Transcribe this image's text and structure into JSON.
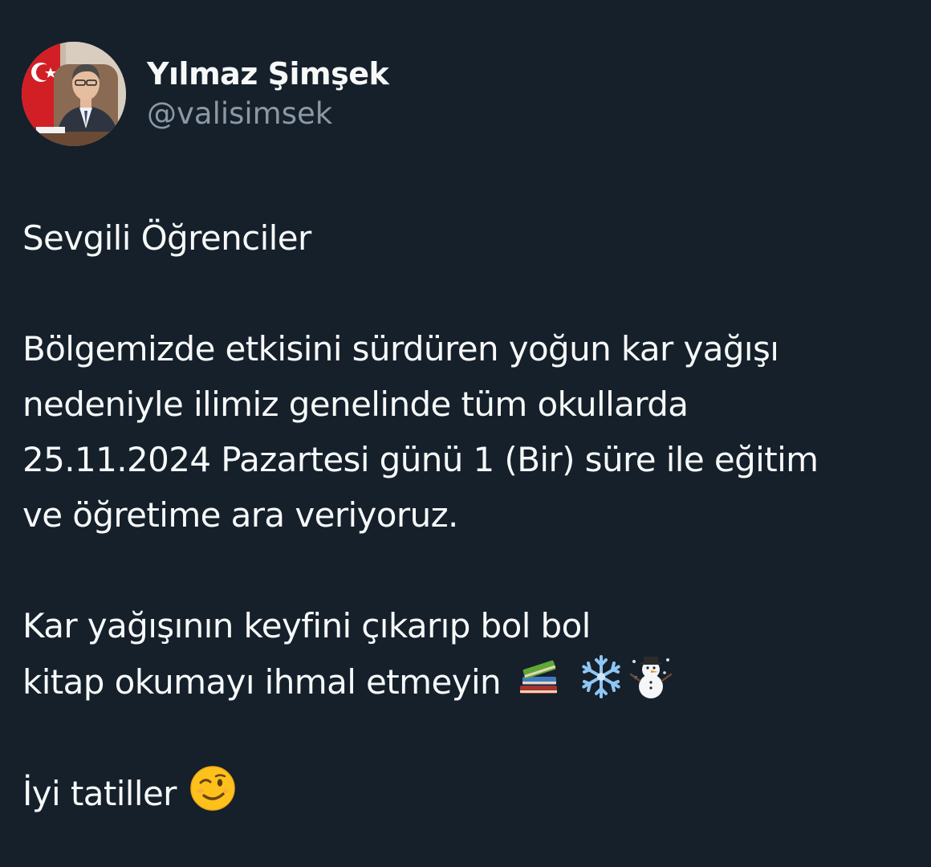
{
  "author": {
    "display_name": "Yılmaz Şimşek",
    "handle": "@valisimsek",
    "avatar_icon": "profile-photo"
  },
  "tweet": {
    "greeting": "Sevgili Öğrenciler",
    "lines": [
      "Bölgemizde etkisini sürdüren yoğun kar yağışı",
      "nedeniyle ilimiz genelinde tüm okullarda",
      "25.11.2024 Pazartesi günü 1 (Bir) süre ile eğitim",
      "ve öğretime ara veriyoruz."
    ],
    "wish_line_1": "Kar yağışının keyfini çıkarıp bol bol",
    "wish_line_2": "kitap okumayı ihmal etmeyin",
    "wish_emojis": [
      "books-emoji",
      "snowflake-emoji",
      "snowman-emoji"
    ],
    "closing": "İyi tatiller",
    "closing_emoji": "winking-face-emoji"
  },
  "colors": {
    "background": "#15202b",
    "text": "#f7f9f9",
    "handle": "#8b98a5"
  }
}
